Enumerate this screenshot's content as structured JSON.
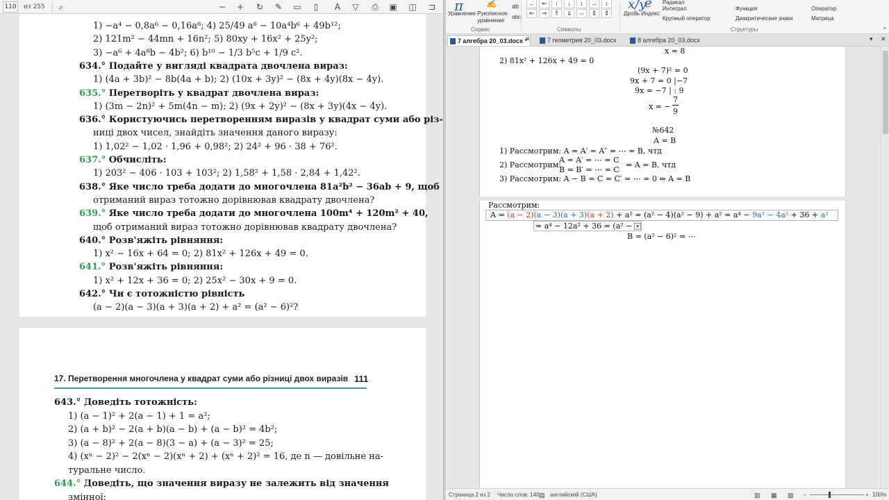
{
  "pdf": {
    "toolbar": {
      "page_number": "110",
      "page_count": "из 255"
    },
    "page1_lines": [
      {
        "n": "",
        "t": "1)  −a⁴ − 0,8a⁶ − 0,16a⁸;                 4)  25/49 a⁸ − 10a⁴b⁶ + 49b¹²;"
      },
      {
        "n": "",
        "t": "2)  121m² − 44mn + 16n²;                  5)  80xy + 16x² + 25y²;"
      },
      {
        "n": "",
        "t": "3)  −a⁶ + 4a⁸b − 4b²;                      6)  b¹⁰ − 1/3 b⁵c + 1/9 c²."
      },
      {
        "n": "634.°",
        "t": " Подайте у вигляді квадрата двочлена вираз:"
      },
      {
        "n": "",
        "t": "1)  (4a + 3b)² − 8b(4a + b);                2)  (10x + 3y)² − (8x + 4y)(8x − 4y)."
      },
      {
        "n": "635.°",
        "t": " Перетворіть у квадрат двочлена вираз:"
      },
      {
        "n": "",
        "t": "1)  (3m − 2n)² + 5m(4n − m);               2)  (9x + 2y)² − (8x + 3y)(4x − 4y)."
      },
      {
        "n": "636.°",
        "t": " Користуючись перетворенням виразів у квадрат суми або різ-"
      },
      {
        "n": "",
        "t": "ниці двох чисел, знайдіть значення даного виразу:"
      },
      {
        "n": "",
        "t": "1)  1,02² − 1,02 · 1,96 + 0,98²;             2)  24² + 96 · 38 + 76²."
      },
      {
        "n": "637.°",
        "t": " Обчисліть:"
      },
      {
        "n": "",
        "t": "1)  203² − 406 · 103 + 103²;               2)  1,58² + 1,58 · 2,84 + 1,42²."
      },
      {
        "n": "638.°",
        "t": " Яке число треба додати до многочлена 81a²b² − 36ab + 9, щоб"
      },
      {
        "n": "",
        "t": "отриманий вираз тотожно дорівнював квадрату двочлена?"
      },
      {
        "n": "639.°",
        "t": " Яке число треба додати до многочлена 100m⁴ + 120m² + 40,"
      },
      {
        "n": "",
        "t": "щоб отриманий вираз тотожно дорівнював квадрату двочлена?"
      },
      {
        "n": "640.°",
        "t": " Розв'яжіть рівняння:"
      },
      {
        "n": "",
        "t": "1)  x² − 16x + 64 = 0;                      2)  81x² + 126x + 49 = 0."
      },
      {
        "n": "641.°",
        "t": " Розв'яжіть рівняння:"
      },
      {
        "n": "",
        "t": "1)  x² + 12x + 36 = 0;                      2)  25x² − 30x + 9 = 0."
      },
      {
        "n": "642.°",
        "t": " Чи є тотожністю рівність"
      },
      {
        "n": "",
        "t": "(a − 2)(a − 3)(a + 3)(a + 2) + a² = (a² − 6)²?"
      }
    ],
    "page2": {
      "chapter_title": "17.  Перетворення многочлена у квадрат суми або різниці двох виразів",
      "chapter_page": "111",
      "lines": [
        {
          "n": "643.°",
          "t": " Доведіть тотожність:"
        },
        {
          "n": "",
          "t": "1)  (a − 1)² + 2(a − 1) + 1 = a²;"
        },
        {
          "n": "",
          "t": "2)  (a + b)² − 2(a + b)(a − b) + (a − b)² = 4b²;"
        },
        {
          "n": "",
          "t": "3)  (a − 8)² + 2(a − 8)(3 − a) + (a − 3)² = 25;"
        },
        {
          "n": "",
          "t": "4)  (xⁿ − 2)² − 2(xⁿ − 2)(xⁿ + 2) + (xⁿ + 2)² = 16,  де  n  —  довільне  на-"
        },
        {
          "n": "",
          "t": "туральне число."
        },
        {
          "n": "644.°",
          "t": " Доведіть, що значення виразу не залежить від значення"
        },
        {
          "n": "",
          "t": "змінної:"
        }
      ]
    }
  },
  "ribbon": {
    "equation_label": "Уравнение",
    "ink_label": "Рукописное уравнение",
    "group_service": "Сервис",
    "group_symbols": "Символы",
    "group_structures": "Структуры",
    "fraction": "Дробь",
    "index": "Индекс",
    "radical": "Радикал",
    "integral": "Интеграл",
    "large_operator": "Крупный оператор",
    "function": "Функция",
    "accents": "Диакритические знаки",
    "operator": "Оператор",
    "matrix": "Матрица",
    "symbols": [
      "←",
      "⇐",
      "↑",
      "↓",
      "↕",
      "↔",
      "↕",
      "⇐",
      "⇒",
      "⇑",
      "⇓",
      "⇔",
      "⇕",
      "⇕"
    ]
  },
  "tabs": [
    {
      "label": "7 алгебра 20_03.docx *",
      "active": true
    },
    {
      "label": "7 геометрия 20_03.docx",
      "active": false
    },
    {
      "label": "8 алгебра 20_03.docx",
      "active": false
    }
  ],
  "doc": {
    "top_line": "x = 8",
    "l1": "2)  81x² + 126x + 49 = 0",
    "l2": "(9x + 7)² = 0",
    "l3": "9x + 7 = 0   |−7",
    "l4": "9x = −7   | : 9",
    "l5a": "x = −",
    "l5n": "7",
    "l5d": "9",
    "n642": "№642",
    "ab": "A = B",
    "c1": "1)  Рассмотрим:  A = A′ = A″ = ⋯ = B, чтд",
    "c2a": "2)  Рассмотрим:",
    "c2b": "A = A′ = ⋯ = C",
    "c2c": "B = B′ = ⋯ = C",
    "c2d": "⇒ A = B, чтд",
    "c3": "3)  Рассмотрим:  A − B = C = C′ = ⋯ = 0 ⇒ A = B",
    "p2_label": "Рассмотрим:",
    "eq1_a": "A = ",
    "eq1_b": "(a − 2)",
    "eq1_c": "(a − 3)(a + 3)",
    "eq1_d": "(a + 2)",
    "eq1_e": " + a² = (a² − 4)(a² − 9) + a² = a⁴ − ",
    "eq1_f": "9a² − 4a²",
    "eq1_g": " + 36 + ",
    "eq1_h": "a²",
    "eq2": "= a⁴ − 12a² + 36 = (a² −",
    "eq3": "B = (a² − 6)² = ⋯"
  },
  "status": {
    "page": "Страница 2 из 2",
    "words": "Число слов: 140",
    "lang": "английский (США)",
    "zoom": "100%"
  }
}
